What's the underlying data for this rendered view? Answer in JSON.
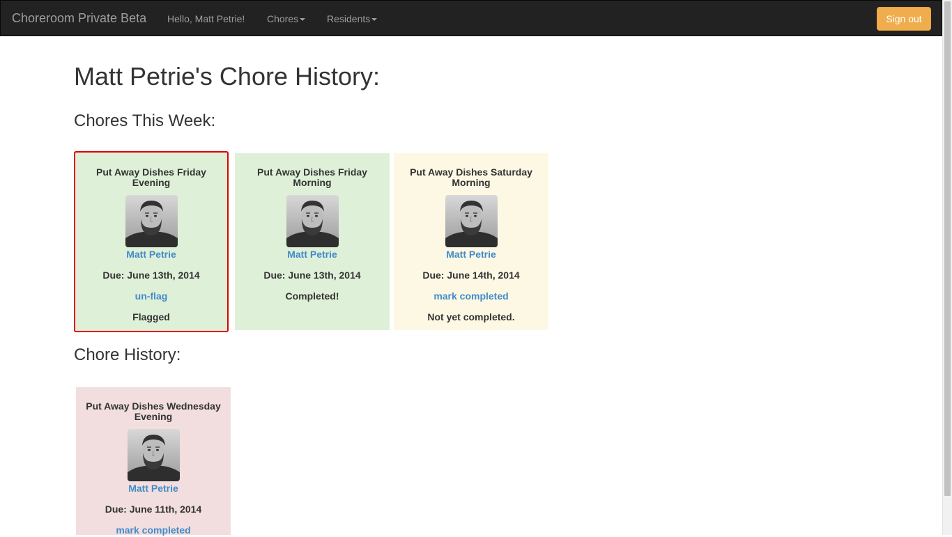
{
  "navbar": {
    "brand": "Choreroom Private Beta",
    "greeting": "Hello, Matt Petrie!",
    "chores_menu": "Chores",
    "residents_menu": "Residents",
    "signout_label": "Sign out"
  },
  "page": {
    "title": "Matt Petrie's Chore History:",
    "this_week_heading": "Chores This Week:",
    "history_heading": "Chore History:"
  },
  "this_week": [
    {
      "title": "Put Away Dishes Friday Evening",
      "name": "Matt Petrie",
      "due": "Due: June 13th, 2014",
      "action": "un-flag",
      "status": "Flagged"
    },
    {
      "title": "Put Away Dishes Friday Morning",
      "name": "Matt Petrie",
      "due": "Due: June 13th, 2014",
      "action": "",
      "status": "Completed!"
    },
    {
      "title": "Put Away Dishes Saturday Morning",
      "name": "Matt Petrie",
      "due": "Due: June 14th, 2014",
      "action": "mark completed",
      "status": "Not yet completed."
    }
  ],
  "history": [
    {
      "title": "Put Away Dishes Wednesday Evening",
      "name": "Matt Petrie",
      "due": "Due: June 11th, 2014",
      "action": "mark completed"
    }
  ],
  "colors": {
    "success_bg": "#dff0d8",
    "warning_bg": "#fcf8e3",
    "danger_bg": "#f2dede",
    "flag_border": "#e00000",
    "link": "#428bca",
    "signout_bg": "#f0ad4e"
  }
}
